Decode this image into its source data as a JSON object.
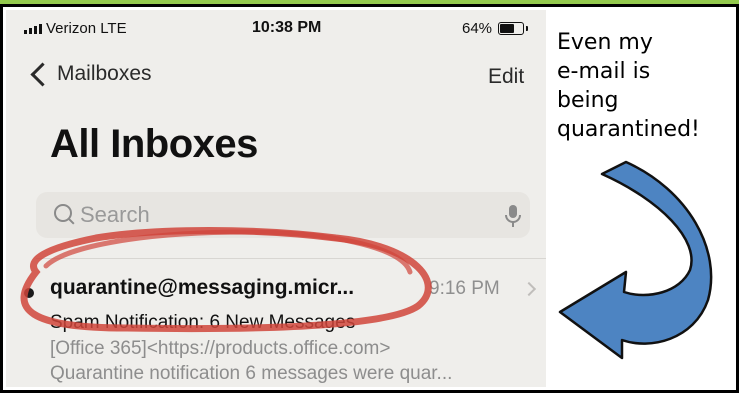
{
  "status_bar": {
    "carrier": "Verizon  LTE",
    "time": "10:38 PM",
    "battery": "64%",
    "battery_level": 0.64
  },
  "nav": {
    "back_label": "Mailboxes",
    "edit_label": "Edit"
  },
  "title": "All Inboxes",
  "search": {
    "placeholder": "Search"
  },
  "message": {
    "sender": "quarantine@messaging.micr...",
    "time": "9:16 PM",
    "subject": "Spam Notification: 6 New Messages",
    "preview_line1": "[Office 365]<https://products.office.com>",
    "preview_line2": "Quarantine notification 6 messages were quar..."
  },
  "annotation": {
    "lines": [
      "Even my",
      "e-mail is",
      "being",
      "quarantined!"
    ],
    "arrow_color": "#4d84c2",
    "circle_color": "#d0453b"
  },
  "colors": {
    "accent_strip": "#93c94d",
    "phone_bg": "#efeeeb"
  }
}
